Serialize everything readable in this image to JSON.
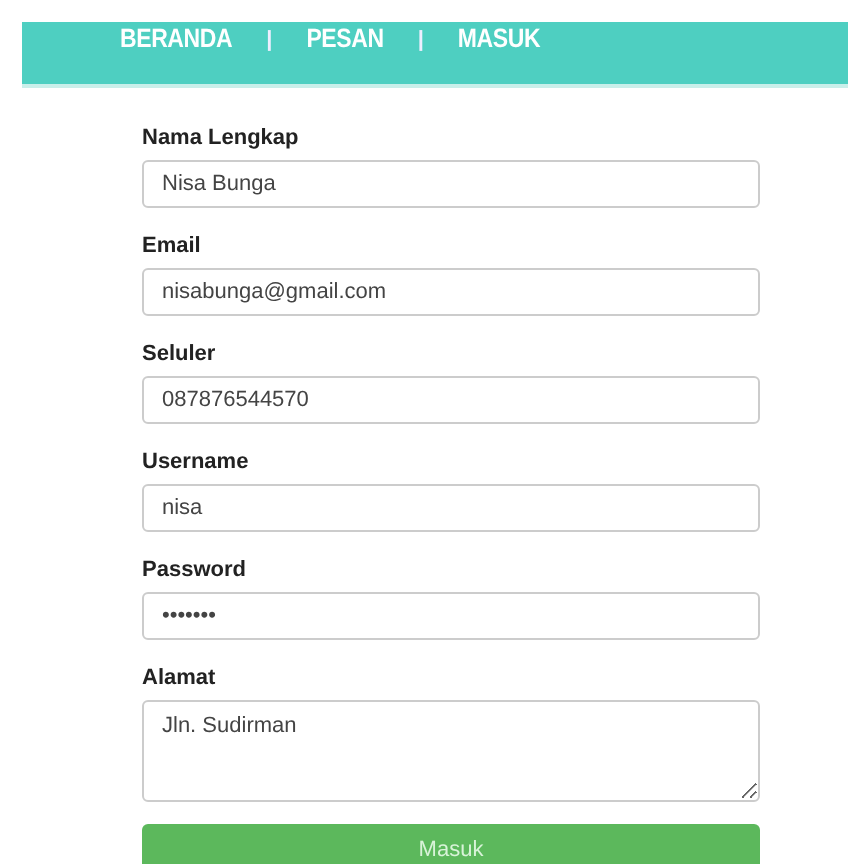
{
  "nav": {
    "items": [
      {
        "kind": "link",
        "label": "BERANDA"
      },
      {
        "kind": "separator",
        "label": "|"
      },
      {
        "kind": "link",
        "label": "PESAN"
      },
      {
        "kind": "separator",
        "label": "|"
      },
      {
        "kind": "link",
        "label": "MASUK"
      }
    ]
  },
  "form": {
    "fields": [
      {
        "kind": "text",
        "label": "Nama Lengkap",
        "value": "Nisa Bunga"
      },
      {
        "kind": "text",
        "label": "Email",
        "value": "nisabunga@gmail.com"
      },
      {
        "kind": "text",
        "label": "Seluler",
        "value": "087876544570"
      },
      {
        "kind": "text",
        "label": "Username",
        "value": "nisa"
      },
      {
        "kind": "text",
        "label": "Password",
        "value": "•••••••"
      },
      {
        "kind": "textarea",
        "label": "Alamat",
        "value": "Jln. Sudirman"
      }
    ],
    "submit": "Masuk"
  }
}
